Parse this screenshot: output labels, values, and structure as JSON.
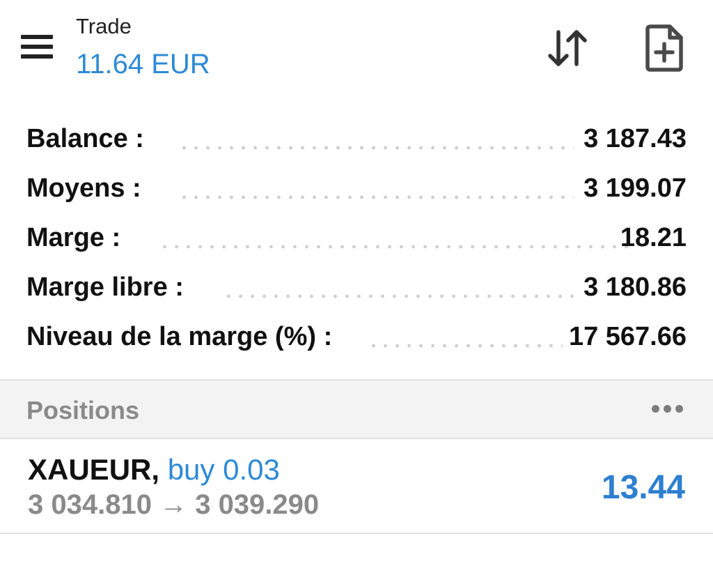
{
  "header": {
    "title": "Trade",
    "profit": "11.64 EUR"
  },
  "account": [
    {
      "label": "Balance :",
      "value": "3 187.43"
    },
    {
      "label": "Moyens :",
      "value": "3 199.07"
    },
    {
      "label": "Marge :",
      "value": "18.21"
    },
    {
      "label": "Marge libre :",
      "value": "3 180.86"
    },
    {
      "label": "Niveau de la marge (%) :",
      "value": "17 567.66"
    }
  ],
  "positions": {
    "title": "Positions",
    "items": [
      {
        "symbol": "XAUEUR,",
        "type": "buy 0.03",
        "open_price": "3 034.810",
        "arrow": "→",
        "current_price": "3 039.290",
        "profit": "13.44"
      }
    ]
  },
  "icons": {
    "menu": "hamburger-menu-icon",
    "sort": "sort-arrows-icon",
    "new_order": "new-order-file-plus-icon",
    "more": "more-horizontal-icon"
  },
  "colors": {
    "accent": "#2d8ad6",
    "profit": "#2d7fd0",
    "muted": "#8a8a8a",
    "section_bg": "#f3f3f3"
  }
}
